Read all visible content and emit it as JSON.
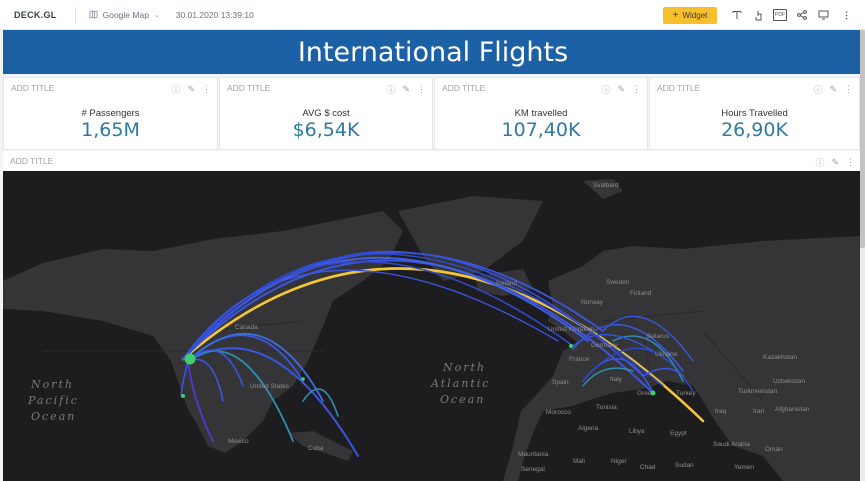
{
  "topbar": {
    "brand": "DECK.GL",
    "map_select": "Google Map",
    "datetime": "30.01.2020 13:39:10",
    "widget_button": "Widget",
    "pdf_icon_text": "PDF"
  },
  "banner": {
    "title": "International Flights"
  },
  "cards": [
    {
      "header": "ADD TITLE",
      "label": "# Passengers",
      "value": "1,65M"
    },
    {
      "header": "ADD TITLE",
      "label": "AVG $ cost",
      "value": "$6,54K"
    },
    {
      "header": "ADD TITLE",
      "label": "KM travelled",
      "value": "107,40K"
    },
    {
      "header": "ADD TITLE",
      "label": "Hours Travelled",
      "value": "26,90K"
    }
  ],
  "map_widget": {
    "header": "ADD TITLE",
    "oceans": {
      "north_pacific": [
        "North",
        "Pacific",
        "Ocean"
      ],
      "north_atlantic": [
        "North",
        "Atlantic",
        "Ocean"
      ]
    },
    "places": {
      "svalbard": "Svalbard",
      "iceland": "Iceland",
      "sweden": "Sweden",
      "finland": "Finland",
      "norway": "Norway",
      "united_kingdom": "United\nKingdom",
      "germany": "Germany",
      "france": "France",
      "belarus": "Belarus",
      "ukraine": "Ukraine",
      "spain": "Spain",
      "italy": "Italy",
      "greece": "Gree",
      "turkey": "Turkey",
      "kazakhstan": "Kazakhstan",
      "uzbekistan": "Uzbekistan",
      "turkmenistan": "Turkmenistan",
      "iran": "Iran",
      "iraq": "Iraq",
      "afghanistan": "Afghanistan",
      "morocco": "Morocco",
      "tunisia": "Tunisia",
      "algeria": "Algeria",
      "libya": "Libya",
      "egypt": "Egypt",
      "mauritania": "Mauritania",
      "mali": "Mali",
      "niger": "Niger",
      "chad": "Chad",
      "sudan": "Sudan",
      "senegal": "Senegal",
      "saudi_arabia": "Saudi\nArabia",
      "oman": "Oman",
      "yemen": "Yemen",
      "united_states": "United\nStates",
      "canada": "Canada",
      "mexico": "Mexico",
      "cuba": "Cuba"
    }
  },
  "colors": {
    "banner": "#1c60a6",
    "value": "#2e7aa3",
    "widget_button": "#f6c02c",
    "map_background": "#1d1d1f",
    "route_blue": "#3a55e0",
    "route_highlight": "#f3c63a",
    "origin_point": "#3ecf6a"
  }
}
